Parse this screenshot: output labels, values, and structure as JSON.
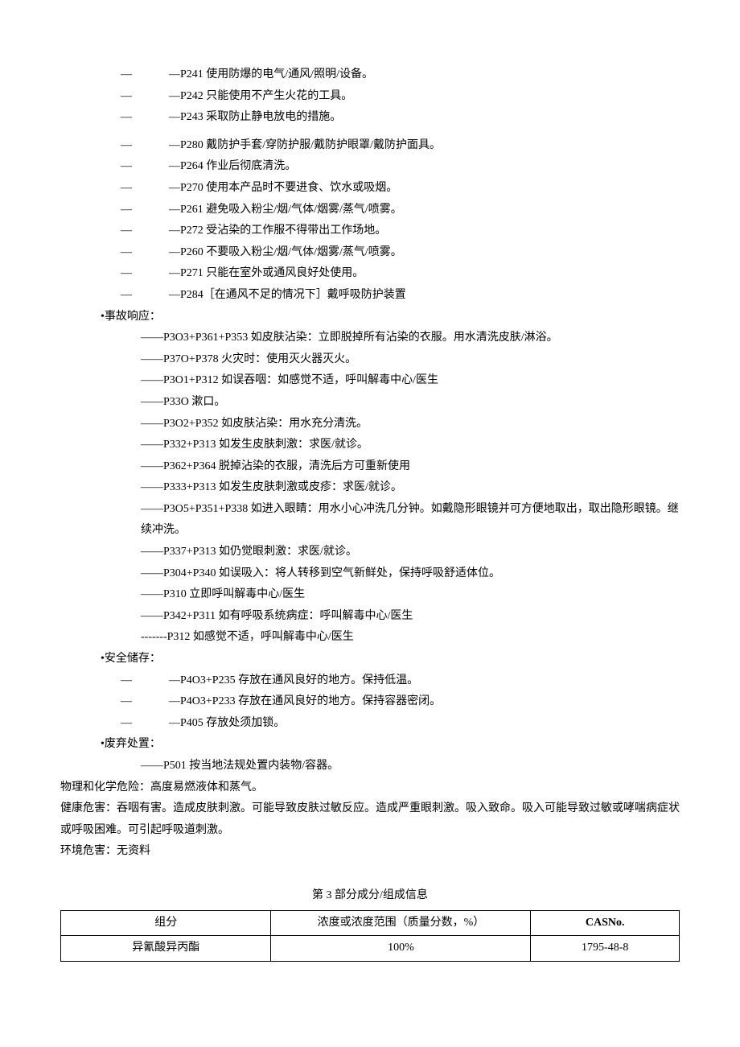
{
  "p1": [
    "—P241 使用防爆的电气/通风/照明/设备。",
    "—P242 只能使用不产生火花的工具。",
    "—P243 采取防止静电放电的措施。"
  ],
  "p2": [
    "—P280 戴防护手套/穿防护服/戴防护眼罩/戴防护面具。",
    "—P264 作业后彻底清洗。",
    "—P270 使用本产品时不要进食、饮水或吸烟。",
    "—P261 避免吸入粉尘/烟/气体/烟雾/蒸气/喷雾。",
    "—P272 受沾染的工作服不得带出工作场地。",
    "—P260 不要吸入粉尘/烟/气体/烟雾/蒸气/喷雾。",
    "—P271 只能在室外或通风良好处使用。",
    "—P284［在通风不足的情况下］戴呼吸防护装置"
  ],
  "accident_label": "•事故响应：",
  "accident": [
    "——P3O3+P361+P353 如皮肤沾染：立即脱掉所有沾染的衣服。用水清洗皮肤/淋浴。",
    "——P37O+P378 火灾时：使用灭火器灭火。",
    "——P3O1+P312 如误吞咽：如感觉不适，呼叫解毒中心/医生",
    "——P33O 漱口。",
    "——P3O2+P352 如皮肤沾染：用水充分清洗。",
    "——P332+P313 如发生皮肤刺激：求医/就诊。",
    "——P362+P364 脱掉沾染的衣服，清洗后方可重新使用",
    "——P333+P313 如发生皮肤刺激或皮疹：求医/就诊。",
    "——P3O5+P351+P338 如进入眼睛：用水小心冲洗几分钟。如戴隐形眼镜并可方便地取出，取出隐形眼镜。继续冲洗。",
    "——P337+P313 如仍觉眼刺激：求医/就诊。",
    "——P304+P340 如误吸入：将人转移到空气新鲜处，保持呼吸舒适体位。",
    "——P310 立即呼叫解毒中心/医生",
    "——P342+P311 如有呼吸系统病症：呼叫解毒中心/医生",
    "-------P312 如感觉不适，呼叫解毒中心/医生"
  ],
  "storage_label": "•安全储存：",
  "storage": [
    "—P4O3+P235 存放在通风良好的地方。保持低温。",
    "—P4O3+P233 存放在通风良好的地方。保持容器密闭。",
    "—P405 存放处须加锁。"
  ],
  "disposal_label": "•废弃处置：",
  "disposal": "——P501 按当地法规处置内装物/容器。",
  "physical": "物理和化学危险：高度易燃液体和蒸气。",
  "health": "健康危害：吞咽有害。造成皮肤刺激。可能导致皮肤过敏反应。造成严重眼刺激。吸入致命。吸入可能导致过敏或哮喘病症状或呼吸困难。可引起呼吸道刺激。",
  "env": "环境危害：无资料",
  "section3_title": "第 3 部分成分/组成信息",
  "table": {
    "headers": [
      "组分",
      "浓度或浓度范围（质量分数，%）",
      "CASNo."
    ],
    "row": [
      "异氰酸异丙酯",
      "100%",
      "1795-48-8"
    ]
  }
}
